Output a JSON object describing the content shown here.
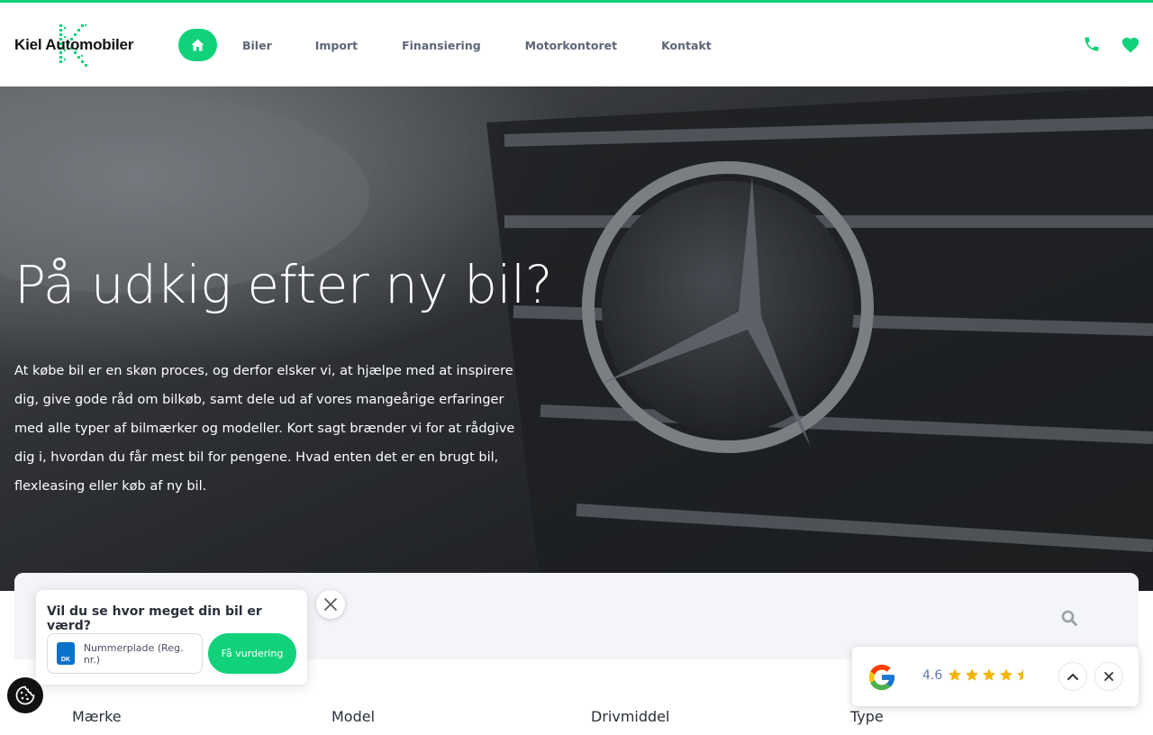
{
  "brand": {
    "name": "Kiel Automobiler",
    "accent_color": "#11d27a"
  },
  "nav": {
    "home_icon": "home-icon",
    "items": [
      {
        "label": "Biler"
      },
      {
        "label": "Import"
      },
      {
        "label": "Finansiering"
      },
      {
        "label": "Motorkontoret"
      },
      {
        "label": "Kontakt"
      }
    ],
    "header_icons": [
      "phone-icon",
      "heart-icon"
    ]
  },
  "hero": {
    "title": "På udkig efter ny bil?",
    "body": "At købe bil er en skøn proces, og derfor elsker vi, at hjælpe med at inspirere dig, give gode råd om bilkøb, samt dele ud af vores mangeårige erfaringer med alle typer af bilmærker og modeller. Kort sagt brænder vi for at rådgive dig i, hvordan du får mest bil for pengene. Hvad enten det er en brugt bil, flexleasing eller køb af ny bil."
  },
  "search": {
    "icon": "search-icon",
    "filters": [
      {
        "label": "Mærke"
      },
      {
        "label": "Model"
      },
      {
        "label": "Drivmiddel"
      },
      {
        "label": "Type"
      }
    ]
  },
  "valuation_popup": {
    "title": "Vil du se hvor meget din bil er værd?",
    "plate_country": "DK",
    "plate_placeholder": "Nummerplade (Reg. nr.)",
    "button_label": "Få vurdering"
  },
  "google_widget": {
    "rating": "4.6",
    "stars": 4.5
  }
}
